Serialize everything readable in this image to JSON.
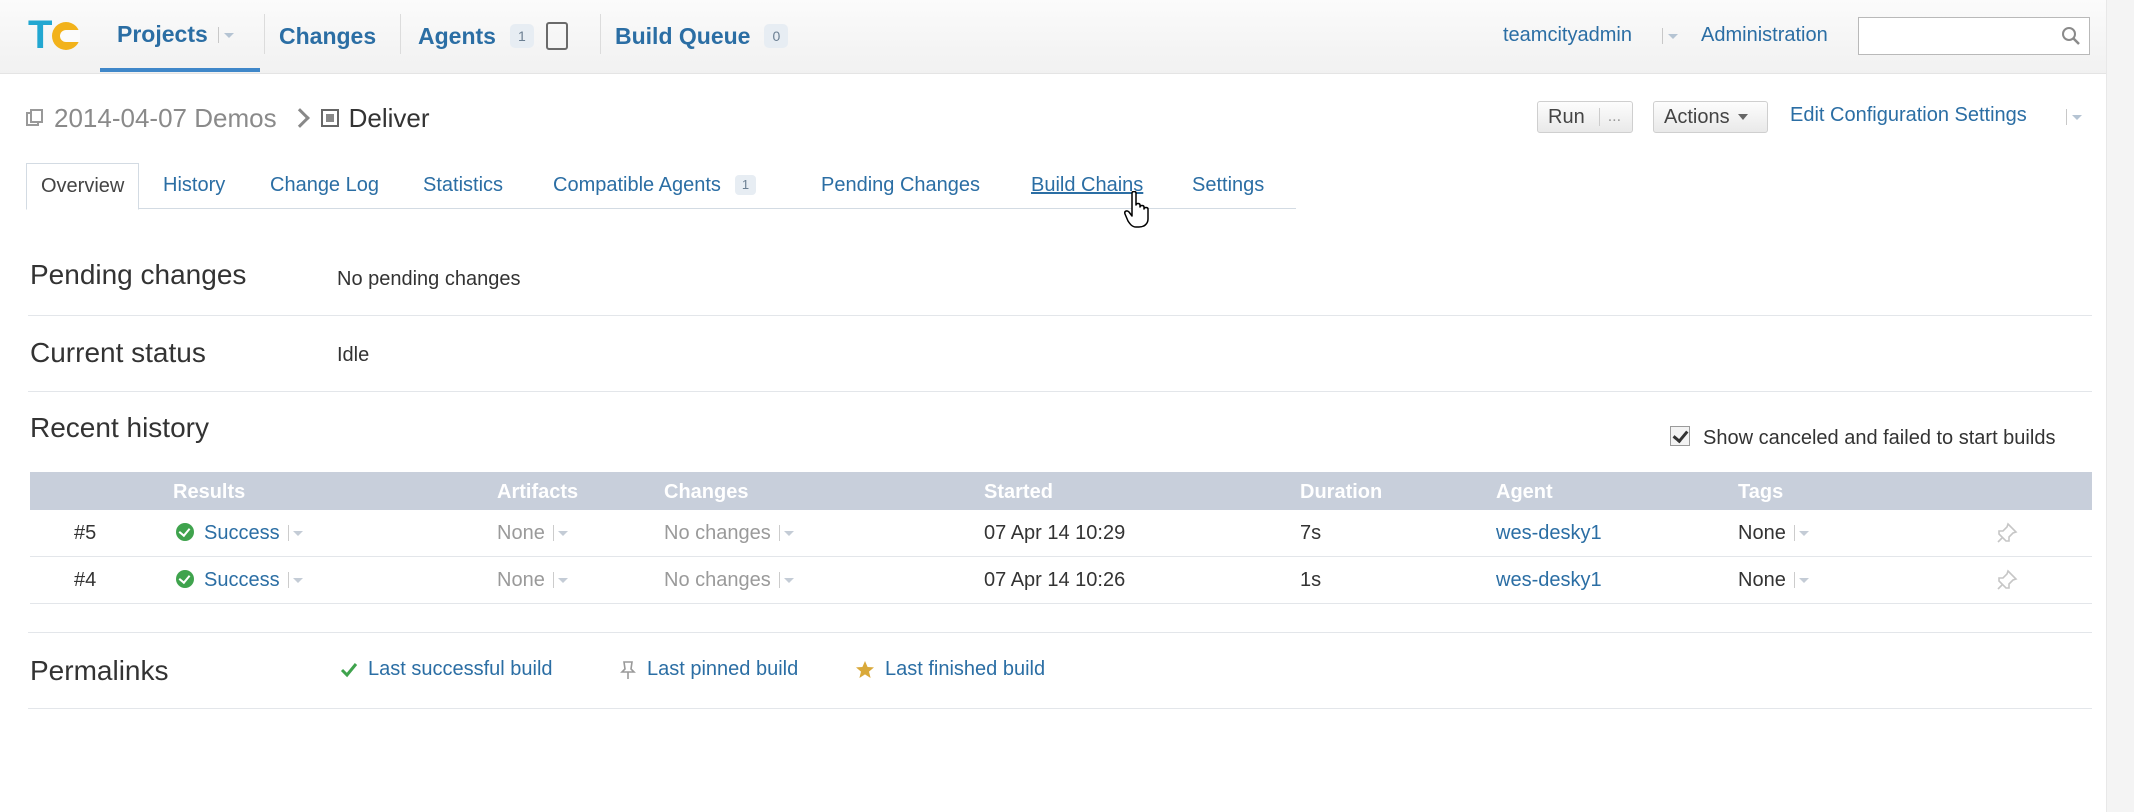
{
  "header": {
    "logo": "TC",
    "nav": [
      {
        "label": "Projects"
      },
      {
        "label": "Changes"
      },
      {
        "label": "Agents",
        "badge": "1"
      },
      {
        "label": "Build Queue",
        "badge": "0"
      }
    ],
    "user": "teamcityadmin",
    "admin": "Administration",
    "search": {
      "value": "",
      "placeholder": ""
    }
  },
  "breadcrumb": {
    "project": "2014-04-07 Demos",
    "config": "Deliver"
  },
  "toolbar": {
    "run": "Run",
    "run_more": "...",
    "actions": "Actions",
    "edit": "Edit Configuration Settings"
  },
  "tabs": [
    {
      "label": "Overview"
    },
    {
      "label": "History"
    },
    {
      "label": "Change Log"
    },
    {
      "label": "Statistics"
    },
    {
      "label": "Compatible Agents",
      "badge": "1"
    },
    {
      "label": "Pending Changes"
    },
    {
      "label": "Build Chains"
    },
    {
      "label": "Settings"
    }
  ],
  "sections": {
    "pending": {
      "title": "Pending changes",
      "value": "No pending changes"
    },
    "status": {
      "title": "Current status",
      "value": "Idle"
    },
    "history": {
      "title": "Recent history",
      "show_canceled": "Show canceled and failed to start builds"
    },
    "permalinks": {
      "title": "Permalinks"
    }
  },
  "history_table": {
    "columns": [
      "Results",
      "Artifacts",
      "Changes",
      "Started",
      "Duration",
      "Agent",
      "Tags"
    ],
    "rows": [
      {
        "num": "#5",
        "result": "Success",
        "artifacts": "None",
        "changes": "No changes",
        "started": "07 Apr 14 10:29",
        "duration": "7s",
        "agent": "wes-desky1",
        "tags": "None"
      },
      {
        "num": "#4",
        "result": "Success",
        "artifacts": "None",
        "changes": "No changes",
        "started": "07 Apr 14 10:26",
        "duration": "1s",
        "agent": "wes-desky1",
        "tags": "None"
      }
    ]
  },
  "permalinks": [
    {
      "label": "Last successful build",
      "icon": "check-icon"
    },
    {
      "label": "Last pinned build",
      "icon": "pin-icon"
    },
    {
      "label": "Last finished build",
      "icon": "star-icon"
    }
  ],
  "colors": {
    "link": "#2b6ea4",
    "success": "#3fa34d",
    "table_header": "#c8cfdb",
    "active_nav": "#3f87c9",
    "star": "#d9a93a"
  }
}
